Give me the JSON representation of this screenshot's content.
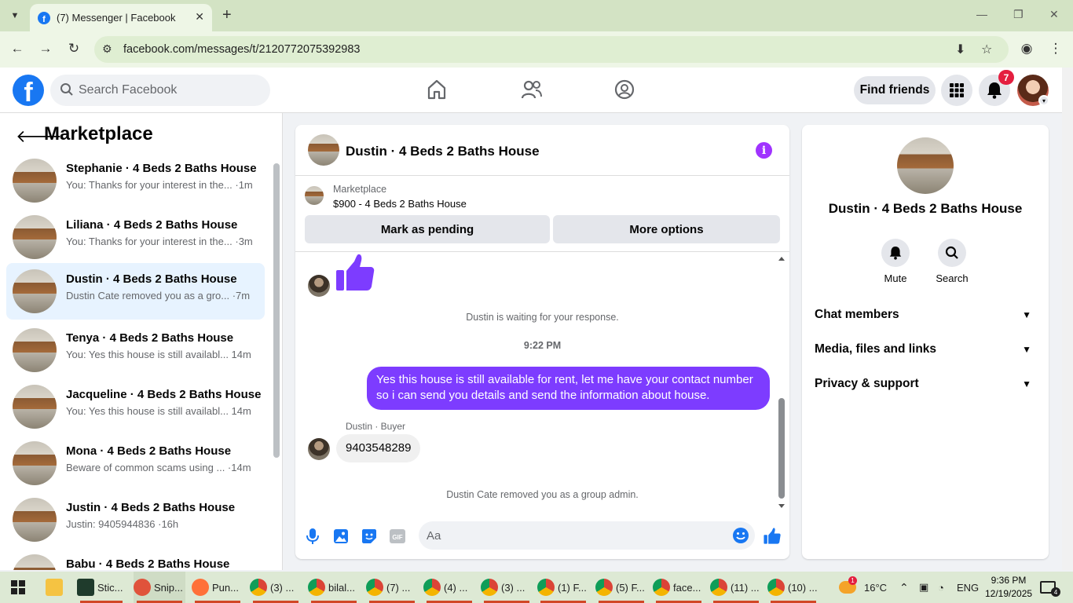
{
  "browser": {
    "tab_title": "(7) Messenger | Facebook",
    "url": "facebook.com/messages/t/2120772075392983"
  },
  "header": {
    "search_placeholder": "Search Facebook",
    "find_friends": "Find friends",
    "notification_count": "7"
  },
  "sidebar": {
    "title": "Marketplace",
    "conversations": [
      {
        "name": "Stephanie · 4 Beds 2 Baths House",
        "snippet": "You: Thanks for your interest in the... ",
        "time": "·1m"
      },
      {
        "name": "Liliana · 4 Beds 2 Baths House",
        "snippet": "You: Thanks for your interest in the... ",
        "time": "·3m"
      },
      {
        "name": "Dustin · 4 Beds 2 Baths House",
        "snippet": "Dustin Cate removed you as a gro... ",
        "time": "·7m"
      },
      {
        "name": "Tenya · 4 Beds 2 Baths House",
        "snippet": "You: Yes this house is still availabl... ",
        "time": "14m"
      },
      {
        "name": "Jacqueline · 4 Beds 2 Baths House",
        "snippet": "You: Yes this house is still availabl... ",
        "time": "14m"
      },
      {
        "name": "Mona · 4 Beds 2 Baths House",
        "snippet": "Beware of common scams using ... ",
        "time": "·14m"
      },
      {
        "name": "Justin · 4 Beds 2 Baths House",
        "snippet": "Justin: 9405944836 ",
        "time": "·16h"
      },
      {
        "name": "Babu · 4 Beds 2 Baths House",
        "snippet": "",
        "time": ""
      }
    ]
  },
  "chat": {
    "title": "Dustin · 4 Beds 2 Baths House",
    "marketplace_label": "Marketplace",
    "listing": "$900 - 4 Beds 2 Baths House",
    "mark_pending": "Mark as pending",
    "more_options": "More options",
    "waiting": "Dustin is waiting for your response.",
    "time_separator": "9:22 PM",
    "outgoing_message": "Yes this house is still available for rent, let me have your contact number so i can send you details and send the information about house.",
    "sender_label": "Dustin · Buyer",
    "incoming_message": "9403548289",
    "system_notice": "Dustin Cate removed you as a group admin.",
    "composer_placeholder": "Aa",
    "accent_color": "#7d3cff"
  },
  "info_panel": {
    "title": "Dustin · 4 Beds 2 Baths House",
    "mute": "Mute",
    "search": "Search",
    "sections": [
      "Chat members",
      "Media, files and links",
      "Privacy & support"
    ]
  },
  "taskbar": {
    "items": [
      "Stic...",
      "Snip...",
      "Pun...",
      "(3) ...",
      "bilal...",
      "(7) ...",
      "(4) ...",
      "(3) ...",
      "(1) F...",
      "(5) F...",
      "face...",
      "(11) ...",
      "(10) ..."
    ],
    "weather_badge": "1",
    "temperature": "16°C",
    "language": "ENG",
    "time": "9:36 PM",
    "date": "12/19/2025",
    "notifications": "4"
  }
}
